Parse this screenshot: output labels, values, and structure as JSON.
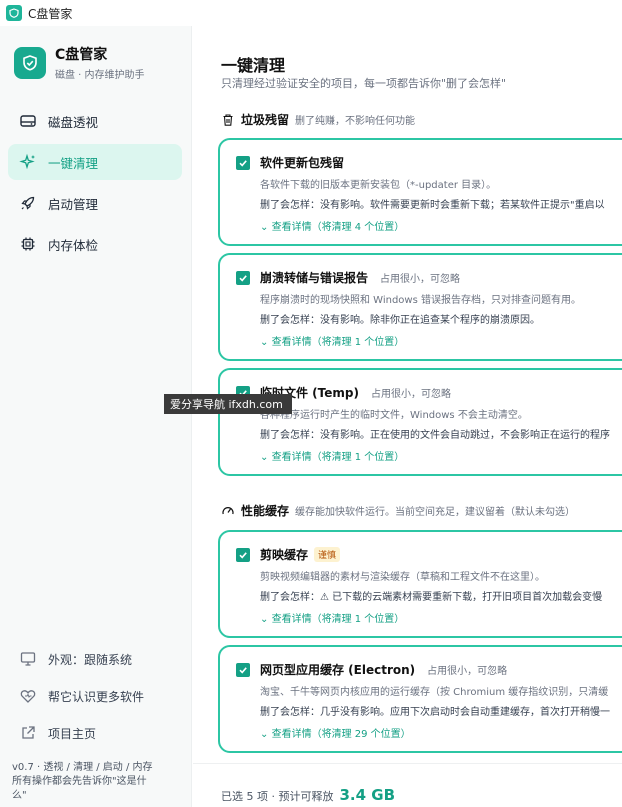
{
  "window": {
    "title": "C盘管家"
  },
  "brand": {
    "name": "C盘管家",
    "subtitle": "磁盘 · 内存维护助手"
  },
  "nav": [
    {
      "label": "磁盘透视",
      "icon": "disk-icon",
      "active": false
    },
    {
      "label": "一键清理",
      "icon": "sparkle-icon",
      "active": true
    },
    {
      "label": "启动管理",
      "icon": "rocket-icon",
      "active": false
    },
    {
      "label": "内存体检",
      "icon": "chip-icon",
      "active": false
    }
  ],
  "bottom_nav": [
    {
      "label": "外观：跟随系统",
      "icon": "monitor-icon"
    },
    {
      "label": "帮它认识更多软件",
      "icon": "heart-icon"
    },
    {
      "label": "项目主页",
      "icon": "external-link-icon"
    }
  ],
  "version": {
    "line1": "v0.7 · 透视 / 清理 / 启动 / 内存",
    "line2": "所有操作都会先告诉你\"这是什",
    "line3": "么\""
  },
  "main": {
    "title": "一键清理",
    "subtitle": "只清理经过验证安全的项目，每一项都告诉你\"删了会怎样\""
  },
  "sections": [
    {
      "title": "垃圾残留",
      "desc": "删了纯赚，不影响任何功能",
      "icon": "trash-icon"
    },
    {
      "title": "性能缓存",
      "desc": "缓存能加快软件运行。当前空间充足，建议留着（默认未勾选）",
      "icon": "gauge-icon"
    }
  ],
  "cards": [
    {
      "title": "软件更新包残留",
      "hint": "",
      "badge": "",
      "desc": "各软件下载的旧版本更新安装包（*-updater 目录）。",
      "effect": "删了会怎样：没有影响。软件需要更新时会重新下载；若某软件正提示\"重启以",
      "detail": "查看详情（将清理 4 个位置）",
      "checked": true
    },
    {
      "title": "崩溃转储与错误报告",
      "hint": "占用很小，可忽略",
      "badge": "",
      "desc": "程序崩溃时的现场快照和 Windows 错误报告存档，只对排查问题有用。",
      "effect": "删了会怎样：没有影响。除非你正在追查某个程序的崩溃原因。",
      "detail": "查看详情（将清理 1 个位置）",
      "checked": true
    },
    {
      "title": "临时文件 (Temp)",
      "hint": "占用很小，可忽略",
      "badge": "",
      "desc": "各种程序运行时产生的临时文件，Windows 不会主动清空。",
      "effect": "删了会怎样：没有影响。正在使用的文件会自动跳过，不会影响正在运行的程序",
      "detail": "查看详情（将清理 1 个位置）",
      "checked": true
    },
    {
      "title": "剪映缓存",
      "hint": "",
      "badge": "谨慎",
      "desc": "剪映视频编辑器的素材与渲染缓存（草稿和工程文件不在这里）。",
      "effect": "删了会怎样：⚠ 已下载的云端素材需要重新下载，打开旧项目首次加载会变慢",
      "detail": "查看详情（将清理 1 个位置）",
      "checked": true
    },
    {
      "title": "网页型应用缓存 (Electron)",
      "hint": "占用很小，可忽略",
      "badge": "",
      "desc": "淘宝、千牛等网页内核应用的运行缓存（按 Chromium 缓存指纹识别，只清缓",
      "effect": "删了会怎样：几乎没有影响。应用下次启动时会自动重建缓存，首次打开稍慢一",
      "detail": "查看详情（将清理 29 个位置）",
      "checked": true
    }
  ],
  "footer": {
    "text": "已选 5 项 · 预计可释放",
    "size": "3.4 GB"
  },
  "watermark": {
    "text": "爱分享导航 ifxdh.com"
  },
  "colors": {
    "accent": "#14a085",
    "card_border": "#2cc6a4",
    "active_bg": "#dcf6ef",
    "badge_bg": "#fdf2d0"
  }
}
